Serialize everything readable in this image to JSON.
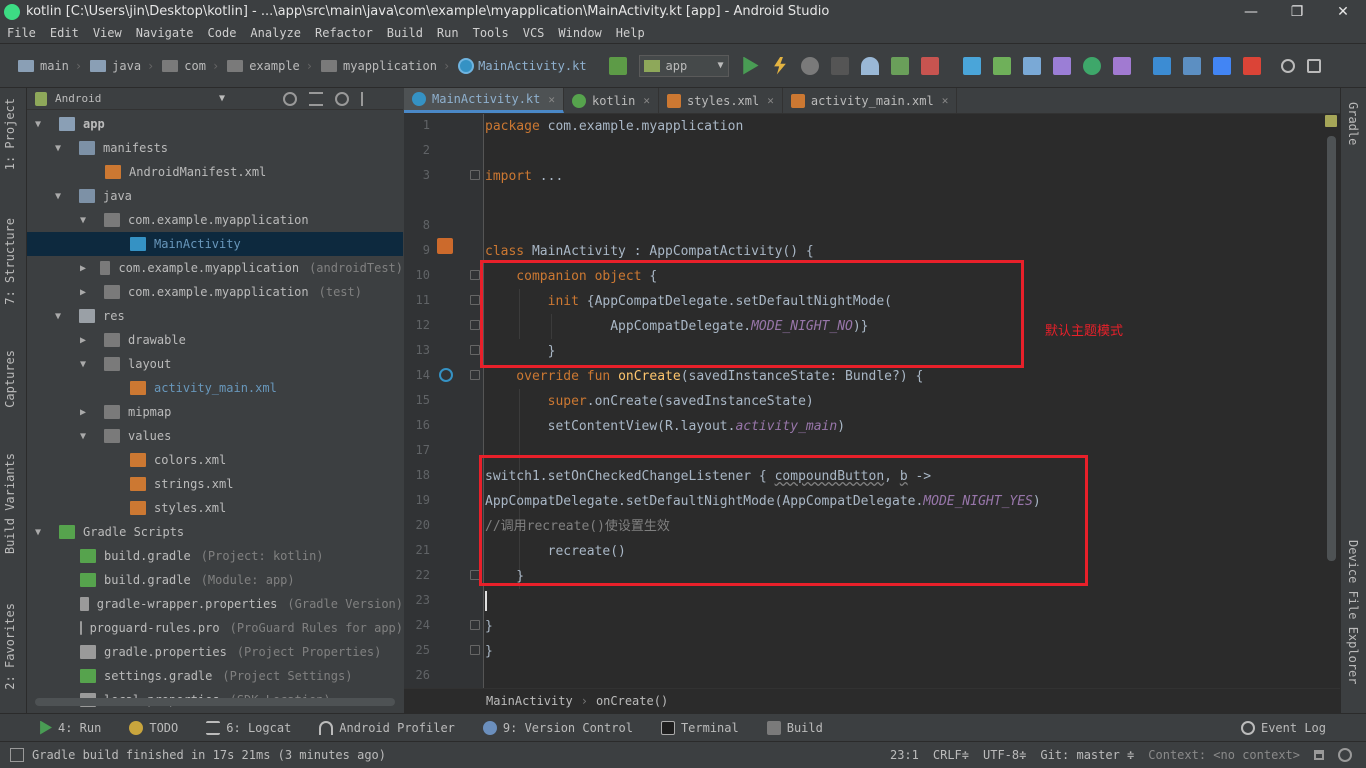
{
  "window": {
    "title": "kotlin [C:\\Users\\jin\\Desktop\\kotlin] - ...\\app\\src\\main\\java\\com\\example\\myapplication\\MainActivity.kt [app] - Android Studio",
    "minimize": "—",
    "maximize": "❐",
    "close": "✕"
  },
  "menu": [
    "File",
    "Edit",
    "View",
    "Navigate",
    "Code",
    "Analyze",
    "Refactor",
    "Build",
    "Run",
    "Tools",
    "VCS",
    "Window",
    "Help"
  ],
  "breadcrumbs": [
    "main",
    "java",
    "com",
    "example",
    "myapplication",
    "MainActivity.kt"
  ],
  "run_config": "app",
  "left_tools": [
    "1: Project",
    "7: Structure",
    "Captures",
    "Build Variants",
    "2: Favorites"
  ],
  "right_tools": [
    "Gradle",
    "Device File Explorer"
  ],
  "project": {
    "view": "Android",
    "tree": [
      {
        "label": "app",
        "hint": ""
      },
      {
        "label": "manifests",
        "hint": ""
      },
      {
        "label": "AndroidManifest.xml",
        "hint": ""
      },
      {
        "label": "java",
        "hint": ""
      },
      {
        "label": "com.example.myapplication",
        "hint": ""
      },
      {
        "label": "MainActivity",
        "hint": ""
      },
      {
        "label": "com.example.myapplication",
        "hint": "(androidTest)"
      },
      {
        "label": "com.example.myapplication",
        "hint": "(test)"
      },
      {
        "label": "res",
        "hint": ""
      },
      {
        "label": "drawable",
        "hint": ""
      },
      {
        "label": "layout",
        "hint": ""
      },
      {
        "label": "activity_main.xml",
        "hint": ""
      },
      {
        "label": "mipmap",
        "hint": ""
      },
      {
        "label": "values",
        "hint": ""
      },
      {
        "label": "colors.xml",
        "hint": ""
      },
      {
        "label": "strings.xml",
        "hint": ""
      },
      {
        "label": "styles.xml",
        "hint": ""
      },
      {
        "label": "Gradle Scripts",
        "hint": ""
      },
      {
        "label": "build.gradle",
        "hint": "(Project: kotlin)"
      },
      {
        "label": "build.gradle",
        "hint": "(Module: app)"
      },
      {
        "label": "gradle-wrapper.properties",
        "hint": "(Gradle Version)"
      },
      {
        "label": "proguard-rules.pro",
        "hint": "(ProGuard Rules for app)"
      },
      {
        "label": "gradle.properties",
        "hint": "(Project Properties)"
      },
      {
        "label": "settings.gradle",
        "hint": "(Project Settings)"
      },
      {
        "label": "local.properties",
        "hint": "(SDK Location)"
      }
    ]
  },
  "tabs": [
    "MainActivity.kt",
    "kotlin",
    "styles.xml",
    "activity_main.xml"
  ],
  "line_numbers": [
    "1",
    "2",
    "3",
    "8",
    "9",
    "10",
    "11",
    "12",
    "13",
    "14",
    "15",
    "16",
    "17",
    "18",
    "19",
    "20",
    "21",
    "22",
    "23",
    "24",
    "25",
    "26"
  ],
  "code": {
    "l1a": "package",
    "l1b": " com.example.myapplication",
    "l3a": "import",
    "l3b": " ...",
    "l9a": "class",
    "l9b": " MainActivity : AppCompatActivity() {",
    "l10a": "    companion object",
    "l10b": " {",
    "l11a": "        init",
    "l11b": " {AppCompatDelegate.setDefaultNightMode(",
    "l12a": "                AppCompatDelegate.",
    "l12b": "MODE_NIGHT_NO",
    "l12c": ")}",
    "l13": "        }",
    "l14a": "    override fun ",
    "l14b": "onCreate",
    "l14c": "(savedInstanceState: Bundle?) {",
    "l15a": "        super",
    "l15b": ".onCreate(savedInstanceState)",
    "l16a": "        setContentView(R.layout.",
    "l16b": "activity_main",
    "l16c": ")",
    "l18a": "switch1.setOnCheckedChangeListener { ",
    "l18b": "compoundButton",
    "l18c": ", ",
    "l18d": "b",
    "l18e": " ->",
    "l19a": "AppCompatDelegate.setDefaultNightMode(AppCompatDelegate.",
    "l19b": "MODE_NIGHT_YES",
    "l19c": ")",
    "l20": "//调用recreate()使设置生效",
    "l21": "        recreate()",
    "l22": "    }",
    "l24": "}",
    "l25": "}"
  },
  "annotation": "默认主题模式",
  "editor_crumbs": [
    "MainActivity",
    "onCreate()"
  ],
  "bottom_tabs": [
    "4: Run",
    "TODO",
    "6: Logcat",
    "Android Profiler",
    "9: Version Control",
    "Terminal",
    "Build",
    "Event Log"
  ],
  "status": {
    "message": "Gradle build finished in 17s 21ms (3 minutes ago)",
    "position": "23:1",
    "line_sep": "CRLF≑",
    "encoding": "UTF-8≑",
    "git": "Git: master ≑",
    "context": "Context: <no context>"
  },
  "colors": {
    "highlight": "#e8202a",
    "selection": "#0d293e",
    "keyword": "#cc7832",
    "function": "#ffc66d",
    "constant": "#9876aa"
  }
}
